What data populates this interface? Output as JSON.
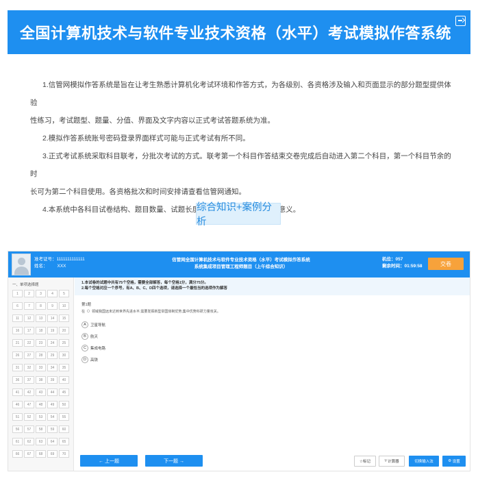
{
  "banner": {
    "title": "全国计算机技术与软件专业技术资格（水平）考试模拟作答系统"
  },
  "notes": [
    {
      "first": "1.信管网模拟作答系统是旨在让考生熟悉计算机化考试环境和作答方式，为各级别、各资格涉及输入和页面显示的部分题型提供体验",
      "cont": "性练习，考试题型、题量、分值、界面及文字内容以正式考试答题系统为准。"
    },
    {
      "first": "2.模拟作答系统账号密码登录界面样式可能与正式考试有所不同。",
      "cont": ""
    },
    {
      "first": "3.正式考试系统采取科目联考，分批次考试的方式。联考第一个科目作答结束交卷完成后自动进入第二个科目，第一个科目节余的时",
      "cont": "长可为第二个科目使用。各资格批次和时间安排请查看信管网通知。"
    },
    {
      "first": "4.本系统中各科目试卷结构、题目数量、试题长度及难度等均不具实际参考意义。",
      "cont": ""
    }
  ],
  "subject_button": "综合知识+案例分析",
  "preview": {
    "candidate_label": "准考证号：1111111111111",
    "name_label": "姓名：",
    "name_value": "XXX",
    "title_line1": "信管网全国计算机技术与软件专业技术资格（水平）考试模拟作答系统",
    "title_line2": "系统集成项目管理工程师题目（上午综合知识）",
    "seat": "机位：057",
    "time": "剩余时间：01:59:58",
    "submit": "交卷",
    "section": "一、单项选择题",
    "question_numbers": [
      "1",
      "2",
      "3",
      "4",
      "5",
      "6",
      "7",
      "8",
      "9",
      "10",
      "11",
      "12",
      "13",
      "14",
      "15",
      "16",
      "17",
      "18",
      "19",
      "20",
      "21",
      "22",
      "23",
      "24",
      "25",
      "26",
      "27",
      "28",
      "29",
      "30",
      "31",
      "32",
      "33",
      "34",
      "35",
      "36",
      "37",
      "38",
      "39",
      "40",
      "41",
      "42",
      "43",
      "44",
      "45",
      "46",
      "47",
      "48",
      "49",
      "50",
      "51",
      "52",
      "53",
      "54",
      "55",
      "56",
      "57",
      "58",
      "59",
      "60",
      "61",
      "62",
      "63",
      "64",
      "65",
      "66",
      "67",
      "68",
      "69",
      "70"
    ],
    "instructions_1": "1.本试卷的试题中共有75个空格，需要全部解答，每个空格1分，满分75分。",
    "instructions_2": "2.每个空格对应一个序号，有A、B、C、D四个选项，请选择一个最恰当的选项作为解答",
    "question_no": "第1题",
    "question_text": "在（）领域我国远未达到世界先进水平,需要发挥新型举国体制优势,集中优势科研力量攻关。",
    "options": [
      {
        "letter": "A",
        "text": "卫星导航"
      },
      {
        "letter": "B",
        "text": "航天"
      },
      {
        "letter": "C",
        "text": "集成电路"
      },
      {
        "letter": "D",
        "text": "高铁"
      }
    ],
    "prev": "←  上一题",
    "next": "下一题  →",
    "mark": "☆标记",
    "calc": "计算器",
    "switch_input": "切换输入法",
    "settings": "设置"
  }
}
